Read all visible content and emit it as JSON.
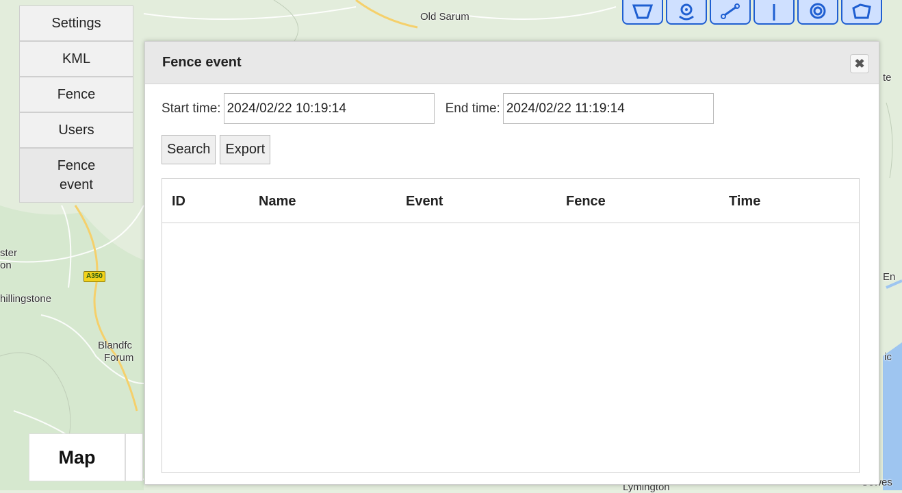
{
  "sidebar": {
    "items": [
      {
        "label": "Settings"
      },
      {
        "label": "KML"
      },
      {
        "label": "Fence"
      },
      {
        "label": "Users"
      },
      {
        "label": "Fence event"
      }
    ]
  },
  "map": {
    "tab_label": "Map",
    "labels": {
      "old_sarum": "Old Sarum",
      "ster": "ster",
      "on": "on",
      "shillingstone": "hillingstone",
      "blandford": "Blandfc",
      "forum": "Forum",
      "lymington": "Lymington",
      "cowes": "Cowes",
      "right_te": "te",
      "right_en": "En",
      "right_ic": "ic"
    },
    "road_shield": "A350"
  },
  "toolbar": {
    "icons": [
      "polygon-icon",
      "location-pin-icon",
      "route-icon",
      "pole-icon",
      "circle-target-icon",
      "polygon-fence-icon"
    ]
  },
  "dialog": {
    "title": "Fence event",
    "start_label": "Start time:",
    "start_value": "2024/02/22 10:19:14",
    "end_label": "End time:",
    "end_value": "2024/02/22 11:19:14",
    "search_label": "Search",
    "export_label": "Export",
    "columns": [
      "ID",
      "Name",
      "Event",
      "Fence",
      "Time"
    ],
    "rows": []
  },
  "colors": {
    "accent": "#1f5fd1",
    "map_land": "#e6efe0",
    "water": "#9ec5f0"
  }
}
